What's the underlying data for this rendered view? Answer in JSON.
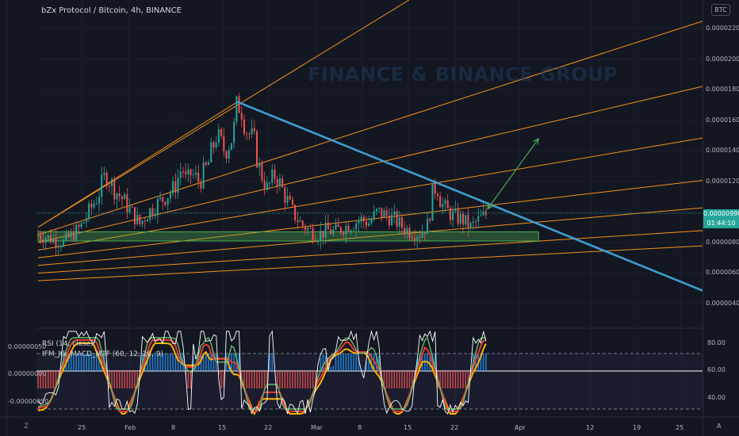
{
  "header": {
    "symbol_title": "bZx Protocol / Bitcoin, 4h, BINANCE"
  },
  "watermark": "FINANCE & BINANCE GROUP",
  "price_scale": {
    "currency_badge": "BTC",
    "current_price": "0.00000990",
    "countdown": "01:44:10"
  },
  "indicator": {
    "rsi_label": "RSI (14, close)",
    "macd_label": "IFM_Jtk_MACD_MTF (60, 12, 26, 9)"
  },
  "icons": {
    "zoom_icon": "Z",
    "auto_label": "A"
  },
  "colors": {
    "bg": "#131722",
    "fan": "#f7931a",
    "trend": "#3d9fd1",
    "zone": "#4caf50",
    "arrow": "#4caf50",
    "up": "#26a69a",
    "down": "#ef5350",
    "rsi": "#ffffff",
    "macd_fast": "#e53935",
    "macd_slow": "#ffb300",
    "macd_sig": "#66bb6a"
  },
  "chart_data": {
    "type": "candlestick",
    "title": "bZx Protocol / Bitcoin, 4h, BINANCE",
    "x_ticks": [
      "25",
      "Feb",
      "8",
      "15",
      "22",
      "Mar",
      "8",
      "15",
      "22",
      "Apr",
      "12",
      "19",
      "25"
    ],
    "y_ticks": [
      "0.00002200",
      "0.00002000",
      "0.00001800",
      "0.00001600",
      "0.00001400",
      "0.00001200",
      "0.00000800",
      "0.00000600",
      "0.00000400"
    ],
    "ylim": [
      3.5e-06,
      2.34e-05
    ],
    "price_path": [
      [
        0,
        8.5e-06
      ],
      [
        6,
        8e-06
      ],
      [
        10,
        9e-06
      ],
      [
        14,
        1.1e-05
      ],
      [
        16,
        1.25e-05
      ],
      [
        18,
        1.15e-05
      ],
      [
        20,
        1.08e-05
      ],
      [
        22,
        1e-05
      ],
      [
        24,
        9.2e-06
      ],
      [
        26,
        1e-05
      ],
      [
        28,
        1.05e-05
      ],
      [
        30,
        1.1e-05
      ],
      [
        32,
        1.15e-05
      ],
      [
        34,
        1.3e-05
      ],
      [
        35,
        1.18e-05
      ],
      [
        36,
        1.25e-05
      ],
      [
        38,
        1.2e-05
      ],
      [
        40,
        1.3e-05
      ],
      [
        42,
        1.5e-05
      ],
      [
        44,
        1.4e-05
      ],
      [
        46,
        1.5e-05
      ],
      [
        47,
        1.72e-05
      ],
      [
        48,
        1.68e-05
      ],
      [
        49,
        1.55e-05
      ],
      [
        50,
        1.5e-05
      ],
      [
        51,
        1.45e-05
      ],
      [
        52,
        1.3e-05
      ],
      [
        54,
        1.15e-05
      ],
      [
        56,
        1.25e-05
      ],
      [
        58,
        1.12e-05
      ],
      [
        60,
        1e-05
      ],
      [
        62,
        9.2e-06
      ],
      [
        64,
        8.8e-06
      ],
      [
        66,
        8.5e-06
      ],
      [
        68,
        8.8e-06
      ],
      [
        70,
        8.7e-06
      ],
      [
        72,
        9e-06
      ],
      [
        74,
        9.2e-06
      ],
      [
        76,
        9.5e-06
      ],
      [
        78,
        9.3e-06
      ],
      [
        80,
        1e-05
      ],
      [
        82,
        9.8e-06
      ],
      [
        84,
        9.5e-06
      ],
      [
        86,
        9e-06
      ],
      [
        88,
        8.7e-06
      ],
      [
        90,
        8.6e-06
      ],
      [
        92,
        9.2e-06
      ],
      [
        93,
        1.12e-05
      ],
      [
        94,
        1.18e-05
      ],
      [
        95,
        1.06e-05
      ],
      [
        96,
        1.02e-05
      ],
      [
        98,
        9.7e-06
      ],
      [
        100,
        9.5e-06
      ],
      [
        102,
        9e-06
      ],
      [
        104,
        9.5e-06
      ],
      [
        106,
        9.9e-06
      ]
    ],
    "x_range": [
      0,
      106
    ],
    "resistance_line": {
      "from": [
        47,
        1.72e-05
      ],
      "to": [
        158,
        4.7e-06
      ]
    },
    "support_zone": {
      "x": [
        0,
        118
      ],
      "y": [
        8.1e-06,
        8.7e-06
      ]
    },
    "projection_arrow": {
      "from": [
        106,
        1.02e-05
      ],
      "to": [
        118,
        1.48e-05
      ]
    },
    "fan_lines": [
      {
        "from": [
          0,
          9e-06
        ],
        "to": [
          47,
          1.72e-05
        ]
      },
      {
        "from": [
          0,
          9e-06
        ],
        "to": [
          100,
          2.6e-05
        ]
      },
      {
        "from": [
          0,
          8.5e-06
        ],
        "to": [
          158,
          2.26e-05
        ]
      },
      {
        "from": [
          0,
          8e-06
        ],
        "to": [
          158,
          1.83e-05
        ]
      },
      {
        "from": [
          0,
          7.5e-06
        ],
        "to": [
          158,
          1.49e-05
        ]
      },
      {
        "from": [
          0,
          7e-06
        ],
        "to": [
          158,
          1.21e-05
        ]
      },
      {
        "from": [
          0,
          6.5e-06
        ],
        "to": [
          158,
          1.03e-05
        ]
      },
      {
        "from": [
          0,
          6e-06
        ],
        "to": [
          158,
          8.8e-06
        ]
      },
      {
        "from": [
          0,
          5.5e-06
        ],
        "to": [
          158,
          7.8e-06
        ]
      }
    ],
    "indicator_ticks_left": [
      "0.00000050",
      "0.00000000",
      "-0.00000050"
    ],
    "indicator_ticks_right": [
      "80.00",
      "60.00",
      "40.00"
    ]
  }
}
